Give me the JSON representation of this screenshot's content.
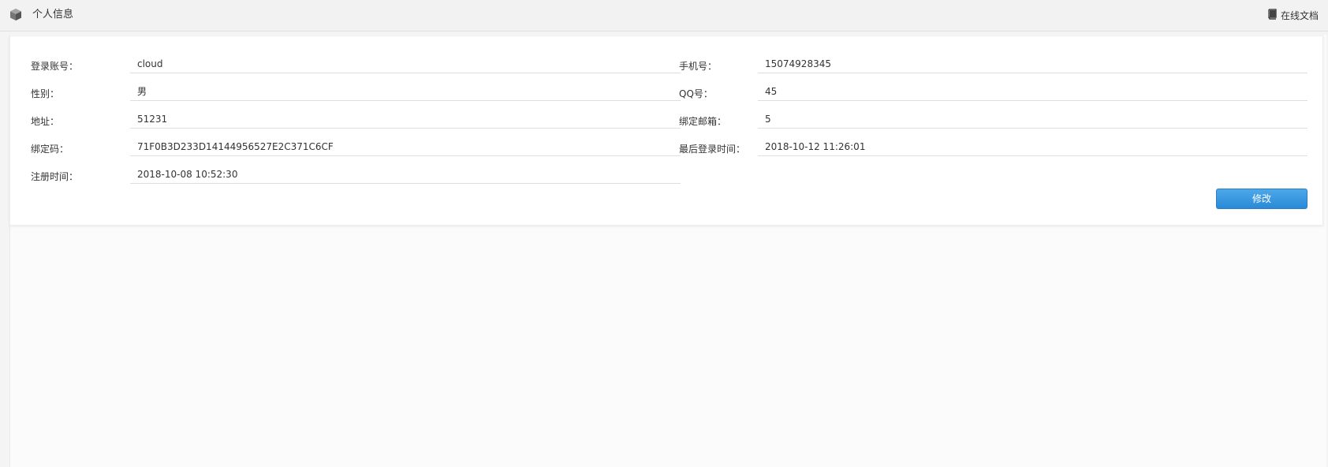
{
  "header": {
    "title": "个人信息",
    "doc_link": "在线文档",
    "icons": {
      "page": "cube-icon",
      "doc": "book-icon"
    }
  },
  "form": {
    "left": [
      {
        "label": "登录账号：",
        "value": "cloud"
      },
      {
        "label": "性别：",
        "value": "男"
      },
      {
        "label": "地址：",
        "value": "51231"
      },
      {
        "label": "绑定码：",
        "value": "71F0B3D233D14144956527E2C371C6CF"
      },
      {
        "label": "注册时间：",
        "value": "2018-10-08 10:52:30"
      }
    ],
    "right": [
      {
        "label": "手机号：",
        "value": "15074928345"
      },
      {
        "label": "QQ号：",
        "value": "45"
      },
      {
        "label": "绑定邮箱：",
        "value": "5"
      },
      {
        "label": "最后登录时间：",
        "value": "2018-10-12 11:26:01"
      }
    ],
    "edit_button": "修改"
  },
  "colors": {
    "accent": "#2a8ad8",
    "background": "#f4f4f4"
  }
}
